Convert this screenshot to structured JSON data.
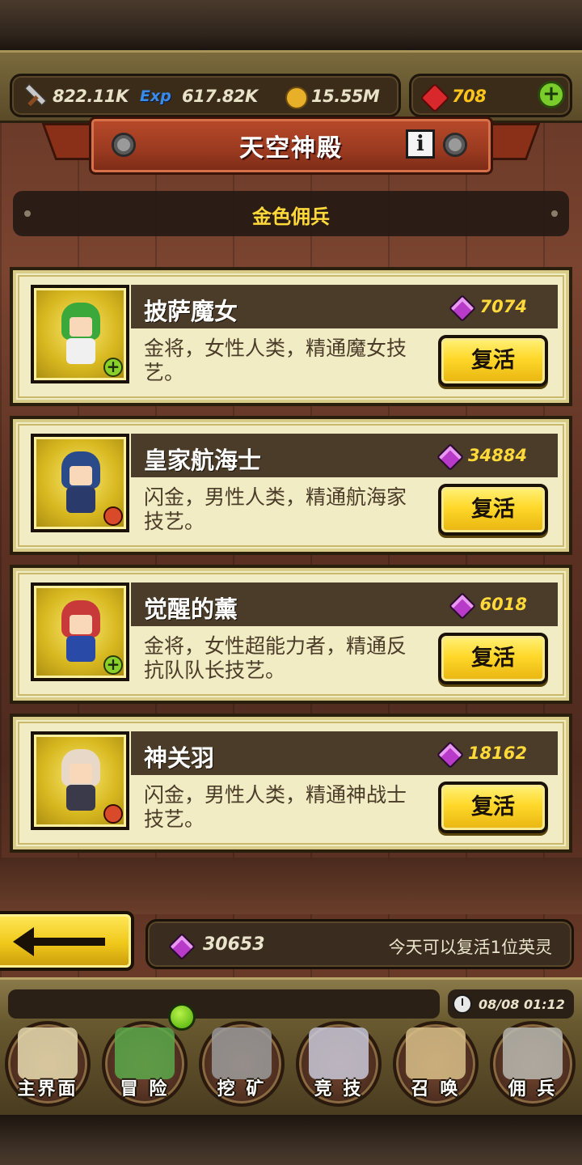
{
  "resources": {
    "attack": {
      "icon": "sword-icon",
      "value": "822.11K"
    },
    "exp": {
      "icon": "exp-icon",
      "label": "Exp",
      "value": "617.82K"
    },
    "gold": {
      "icon": "gold-coin-icon",
      "value": "15.55M"
    },
    "ruby": {
      "icon": "ruby-icon",
      "value": "708"
    },
    "add_label": "+"
  },
  "header": {
    "title": "天空神殿",
    "info_label": "i"
  },
  "category": {
    "label": "金色佣兵"
  },
  "heroes": [
    {
      "name": "披萨魔女",
      "cost": "7074",
      "description": "金将，女性人类，精通魔女技艺。",
      "revive_label": "复活",
      "badge": "plus",
      "hair_color": "#3aa83a",
      "body_color": "#f0f0f0"
    },
    {
      "name": "皇家航海士",
      "cost": "34884",
      "description": "闪金，男性人类，精通航海家技艺。",
      "revive_label": "复活",
      "badge": "fire",
      "hair_color": "#2a4a8a",
      "body_color": "#2a3a6a"
    },
    {
      "name": "觉醒的薰",
      "cost": "6018",
      "description": "金将，女性超能力者，精通反抗队队长技艺。",
      "revive_label": "复活",
      "badge": "plus",
      "hair_color": "#c83a3a",
      "body_color": "#2a4aa8"
    },
    {
      "name": "神关羽",
      "cost": "18162",
      "description": "闪金，男性人类，精通神战士技艺。",
      "revive_label": "复活",
      "badge": "fire",
      "hair_color": "#e8d8c8",
      "body_color": "#3a3a4a"
    }
  ],
  "footer": {
    "gem_balance": "30653",
    "note": "今天可以复活1位英灵",
    "datetime": "08/08 01:12"
  },
  "nav": [
    {
      "label": "主界面",
      "icon": "map-scroll-icon",
      "color": "#e8dcb0"
    },
    {
      "label": "冒 险",
      "icon": "island-icon",
      "color": "#5aa84a"
    },
    {
      "label": "挖 矿",
      "icon": "pickaxe-icon",
      "color": "#9a9a9a"
    },
    {
      "label": "竞 技",
      "icon": "crossed-swords-icon",
      "color": "#c8c8d8"
    },
    {
      "label": "召 唤",
      "icon": "summon-scroll-icon",
      "color": "#d8c088"
    },
    {
      "label": "佣 兵",
      "icon": "tent-icon",
      "color": "#b8b8b0"
    }
  ],
  "colors": {
    "gold_accent": "#ffd83a",
    "card_bg": "#f2ecc4",
    "button_yellow": "#ffd82a",
    "banner_red": "#9a3a20"
  }
}
